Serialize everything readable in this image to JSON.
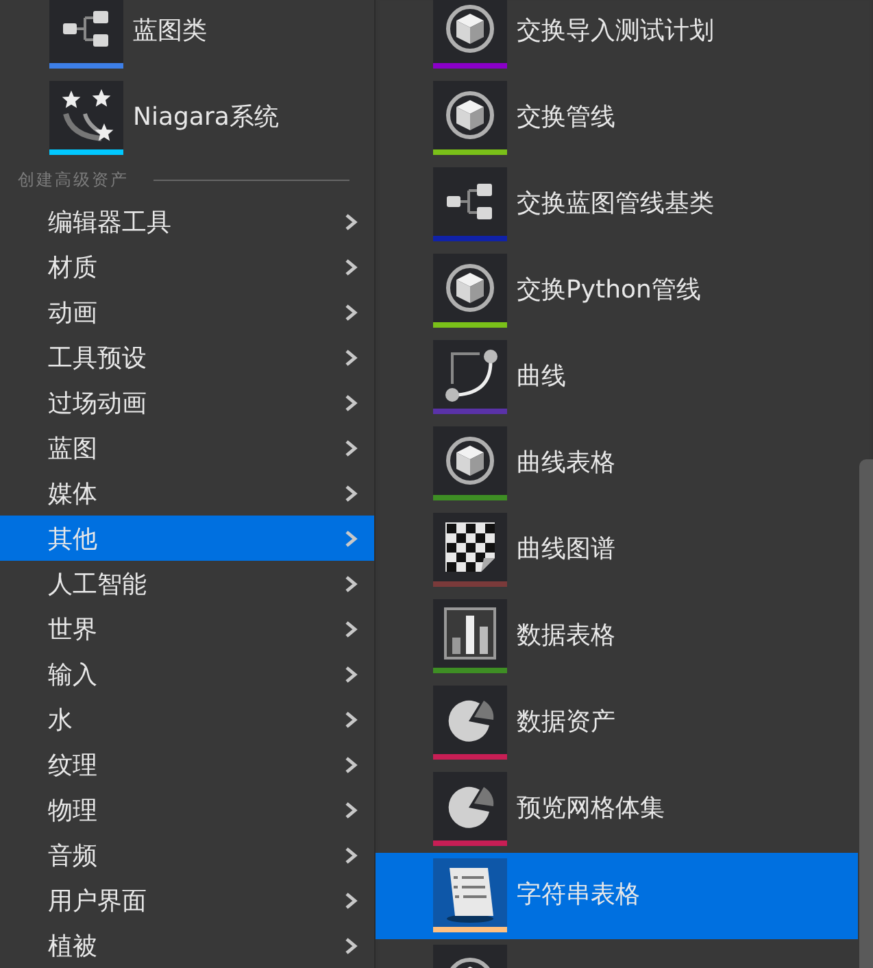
{
  "top_assets": [
    {
      "label": "蓝图类",
      "kind": "graph",
      "color": "#3d7fe8",
      "selected": false
    },
    {
      "label": "Niagara系统",
      "kind": "stars",
      "color": "#00c8ff",
      "selected": false
    }
  ],
  "section_header": "创建高级资产",
  "categories": [
    {
      "label": "编辑器工具",
      "selected": false
    },
    {
      "label": "材质",
      "selected": false
    },
    {
      "label": "动画",
      "selected": false
    },
    {
      "label": "工具预设",
      "selected": false
    },
    {
      "label": "过场动画",
      "selected": false
    },
    {
      "label": "蓝图",
      "selected": false
    },
    {
      "label": "媒体",
      "selected": false
    },
    {
      "label": "其他",
      "selected": true
    },
    {
      "label": "人工智能",
      "selected": false
    },
    {
      "label": "世界",
      "selected": false
    },
    {
      "label": "输入",
      "selected": false
    },
    {
      "label": "水",
      "selected": false
    },
    {
      "label": "纹理",
      "selected": false
    },
    {
      "label": "物理",
      "selected": false
    },
    {
      "label": "音频",
      "selected": false
    },
    {
      "label": "用户界面",
      "selected": false
    },
    {
      "label": "植被",
      "selected": false
    }
  ],
  "submenu": {
    "items": [
      {
        "label": "交换导入测试计划",
        "kind": "cube",
        "color": "#8a00c8",
        "selected": false
      },
      {
        "label": "交换管线",
        "kind": "cube",
        "color": "#7ac019",
        "selected": false
      },
      {
        "label": "交换蓝图管线基类",
        "kind": "graph",
        "color": "#1022a8",
        "selected": false
      },
      {
        "label": "交换Python管线",
        "kind": "cube",
        "color": "#7ac019",
        "selected": false
      },
      {
        "label": "曲线",
        "kind": "curve",
        "color": "#5a32a8",
        "selected": false
      },
      {
        "label": "曲线表格",
        "kind": "cube",
        "color": "#3e8e24",
        "selected": false
      },
      {
        "label": "曲线图谱",
        "kind": "checker",
        "color": "#7a3a3a",
        "selected": false
      },
      {
        "label": "数据表格",
        "kind": "barchart",
        "color": "#3e8e24",
        "selected": false
      },
      {
        "label": "数据资产",
        "kind": "pie",
        "color": "#c81e55",
        "selected": false
      },
      {
        "label": "预览网格体集",
        "kind": "pie",
        "color": "#c81e55",
        "selected": false
      },
      {
        "label": "字符串表格",
        "kind": "document",
        "color": "#ffc080",
        "selected": true
      },
      {
        "kind": "cube",
        "selected": false
      }
    ]
  }
}
